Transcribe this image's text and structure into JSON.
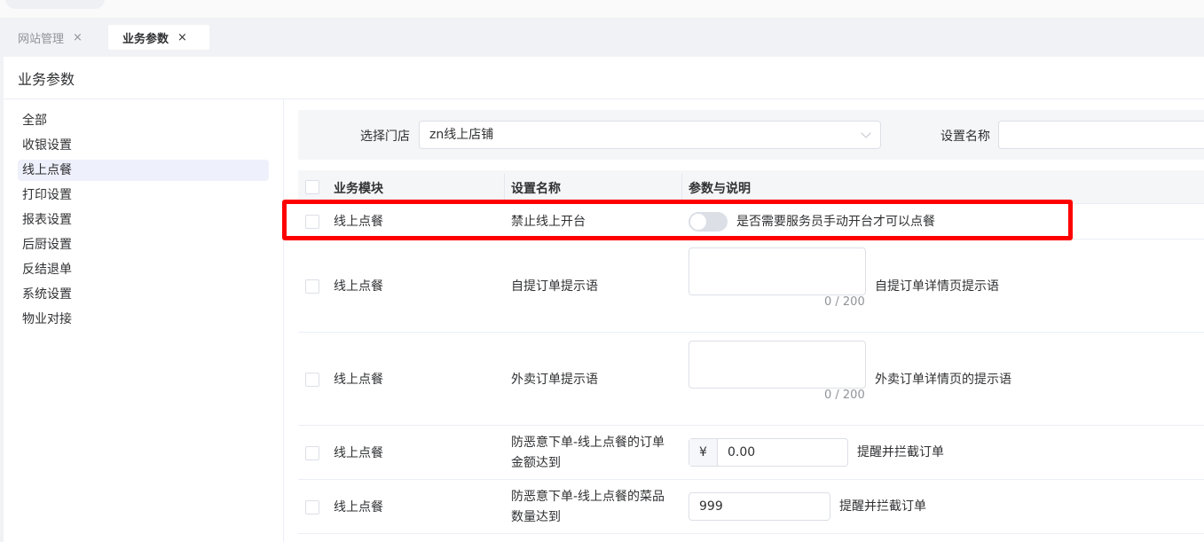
{
  "tabs": [
    {
      "label": "网站管理",
      "active": false
    },
    {
      "label": "业务参数",
      "active": true
    }
  ],
  "tab_close_glyph": "×",
  "page": {
    "title": "业务参数"
  },
  "sidebar": {
    "items": [
      {
        "label": "全部"
      },
      {
        "label": "收银设置"
      },
      {
        "label": "线上点餐",
        "active": true
      },
      {
        "label": "打印设置"
      },
      {
        "label": "报表设置"
      },
      {
        "label": "后厨设置"
      },
      {
        "label": "反结退单"
      },
      {
        "label": "系统设置"
      },
      {
        "label": "物业对接"
      }
    ]
  },
  "filters": {
    "store_label": "选择门店",
    "store_value": "zn线上店铺",
    "name_label": "设置名称",
    "name_value": ""
  },
  "table": {
    "headers": {
      "module": "业务模块",
      "name": "设置名称",
      "param": "参数与说明"
    },
    "rows": [
      {
        "module": "线上点餐",
        "name": "禁止线上开台",
        "control": "switch",
        "switch_on": false,
        "desc": "是否需要服务员手动开台才可以点餐",
        "highlighted": true
      },
      {
        "module": "线上点餐",
        "name": "自提订单提示语",
        "control": "textarea",
        "value": "",
        "counter": "0 / 200",
        "desc": "自提订单详情页提示语"
      },
      {
        "module": "线上点餐",
        "name": "外卖订单提示语",
        "control": "textarea",
        "value": "",
        "counter": "0 / 200",
        "desc": "外卖订单详情页的提示语"
      },
      {
        "module": "线上点餐",
        "name_line1": "防恶意下单-线上点餐的订单",
        "name_line2": "金额达到",
        "control": "money",
        "prefix": "¥",
        "value": "0.00",
        "desc": "提醒并拦截订单"
      },
      {
        "module": "线上点餐",
        "name_line1": "防恶意下单-线上点餐的菜品",
        "name_line2": "数量达到",
        "control": "number",
        "value": "999",
        "desc": "提醒并拦截订单"
      }
    ]
  },
  "colors": {
    "accent": "#5b6cf0",
    "highlight": "#ff0000",
    "active_bg": "#eef0fb"
  },
  "icons": {
    "textarea_icon": "emoji-pen-icon",
    "dropdown": "chevron-down-icon"
  }
}
